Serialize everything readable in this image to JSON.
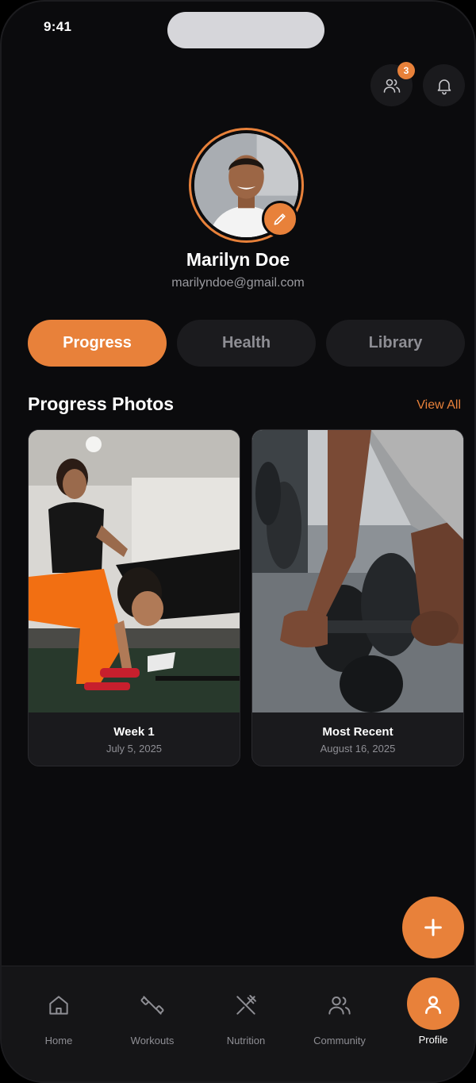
{
  "status_bar": {
    "time": "9:41"
  },
  "header": {
    "friends_badge_count": "3"
  },
  "profile": {
    "name": "Marilyn Doe",
    "email": "marilyndoe@gmail.com"
  },
  "tabs": [
    {
      "label": "Progress",
      "active": true
    },
    {
      "label": "Health",
      "active": false
    },
    {
      "label": "Library",
      "active": false
    }
  ],
  "section": {
    "title": "Progress Photos",
    "view_all_label": "View All"
  },
  "photos": [
    {
      "title": "Week 1",
      "date": "July 5, 2025"
    },
    {
      "title": "Most Recent",
      "date": "August 16, 2025"
    }
  ],
  "bottom_nav": [
    {
      "label": "Home",
      "icon": "home-icon"
    },
    {
      "label": "Workouts",
      "icon": "dumbbell-icon"
    },
    {
      "label": "Nutrition",
      "icon": "utensils-icon"
    },
    {
      "label": "Community",
      "icon": "users-icon"
    },
    {
      "label": "Profile",
      "icon": "user-icon",
      "active": true
    }
  ],
  "colors": {
    "accent": "#e8813a",
    "background": "#0b0b0d",
    "surface": "#1a1a1d",
    "muted_text": "#8e8e94"
  }
}
